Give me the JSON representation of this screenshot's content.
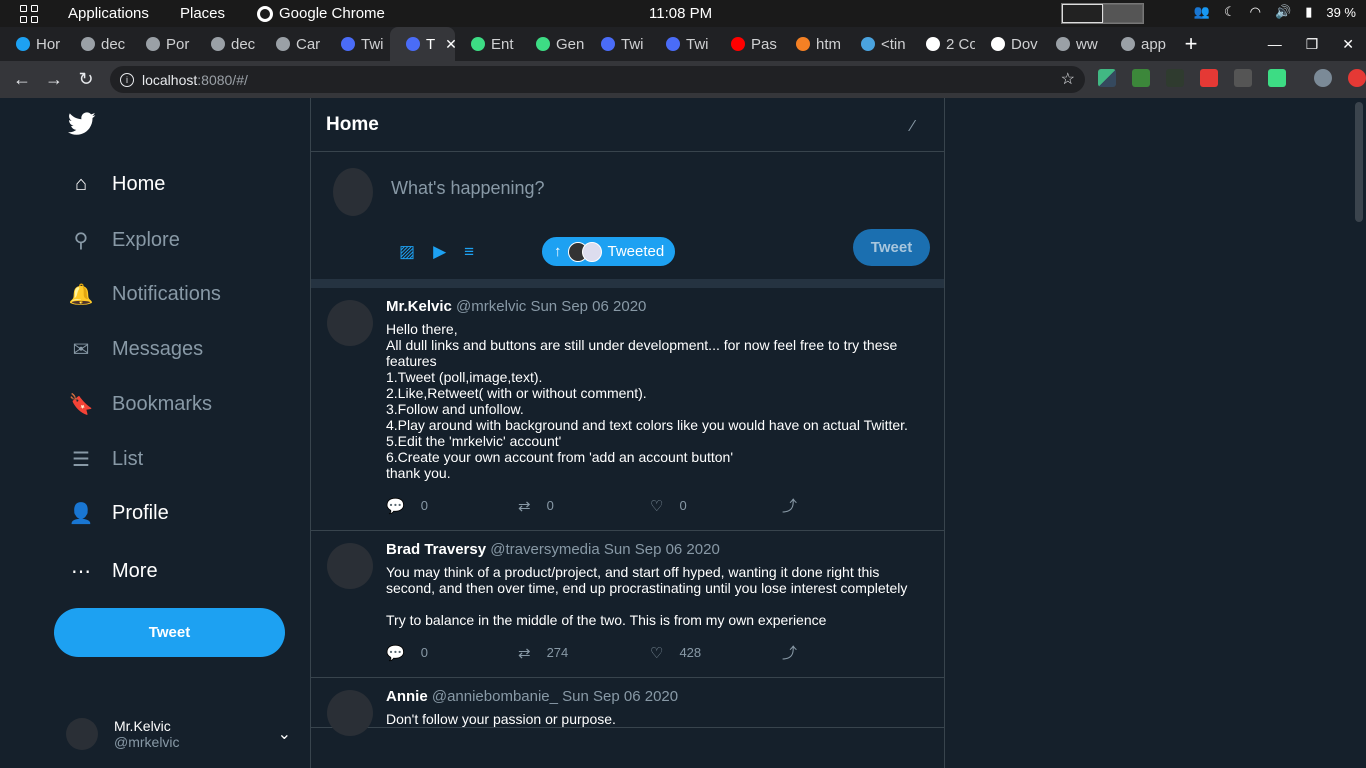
{
  "system_bar": {
    "applications": "Applications",
    "places": "Places",
    "browser_app": "Google Chrome",
    "time": "11:08 PM",
    "battery": "39 %"
  },
  "tabs": [
    {
      "label": "Hor",
      "color": "#1da1f2"
    },
    {
      "label": "dec",
      "color": "#9aa0a6"
    },
    {
      "label": "Por",
      "color": "#9aa0a6"
    },
    {
      "label": "dec",
      "color": "#9aa0a6"
    },
    {
      "label": "Car",
      "color": "#9aa0a6"
    },
    {
      "label": "Twi",
      "color": "#4a6cf7"
    },
    {
      "label": "T",
      "color": "#4a6cf7",
      "active": true
    },
    {
      "label": "Ent",
      "color": "#3ddc84"
    },
    {
      "label": "Gen",
      "color": "#3ddc84"
    },
    {
      "label": "Twi",
      "color": "#4a6cf7"
    },
    {
      "label": "Twi",
      "color": "#4a6cf7"
    },
    {
      "label": "Pas",
      "color": "#ff0000"
    },
    {
      "label": "htm",
      "color": "#f48024"
    },
    {
      "label": "<tin",
      "color": "#4aa3df"
    },
    {
      "label": "2 Co",
      "color": "#ffffff"
    },
    {
      "label": "Dov",
      "color": "#ffffff"
    },
    {
      "label": "ww",
      "color": "#9aa0a6"
    },
    {
      "label": "app",
      "color": "#9aa0a6"
    }
  ],
  "address_bar": {
    "host": "localhost",
    "rest": ":8080/#/"
  },
  "sidebar": {
    "nav": [
      {
        "label": "Home",
        "icon": "home-icon",
        "active": true
      },
      {
        "label": "Explore",
        "icon": "search-icon"
      },
      {
        "label": "Notifications",
        "icon": "bell-icon"
      },
      {
        "label": "Messages",
        "icon": "mail-icon"
      },
      {
        "label": "Bookmarks",
        "icon": "bookmark-icon"
      },
      {
        "label": "List",
        "icon": "list-icon"
      },
      {
        "label": "Profile",
        "icon": "user-icon",
        "active": true
      },
      {
        "label": "More",
        "icon": "more-icon",
        "active": true
      }
    ],
    "tweet_button": "Tweet",
    "account_name": "Mr.Kelvic",
    "account_handle": "@mrkelvic"
  },
  "main": {
    "title": "Home",
    "compose_placeholder": "What's happening?",
    "compose_button": "Tweet",
    "toast": "Tweeted"
  },
  "tweets": [
    {
      "name": "Mr.Kelvic",
      "handle": "@mrkelvic",
      "date": "Sun Sep 06 2020",
      "text": "Hello there,\nAll dull links and buttons are still under development... for now feel free to try these features\n1.Tweet (poll,image,text).\n2.Like,Retweet( with or without comment).\n3.Follow and unfollow.\n4.Play around with background and text colors like you would have on actual Twitter.\n5.Edit the 'mrkelvic' account'\n6.Create your own account from 'add an account button'\nthank you.",
      "comments": "0",
      "retweets": "0",
      "likes": "0"
    },
    {
      "name": "Brad Traversy",
      "handle": "@traversymedia",
      "date": "Sun Sep 06 2020",
      "text": "You may think of a product/project, and start off hyped, wanting it done right this second, and then over time, end up procrastinating until you lose interest completely\n\nTry to balance in the middle of the two. This is from my own experience",
      "comments": "0",
      "retweets": "274",
      "likes": "428"
    },
    {
      "name": "Annie",
      "handle": "@anniebombanie_",
      "date": "Sun Sep 06 2020",
      "text": "Don't follow your passion or purpose.",
      "comments": "",
      "retweets": "",
      "likes": ""
    }
  ]
}
